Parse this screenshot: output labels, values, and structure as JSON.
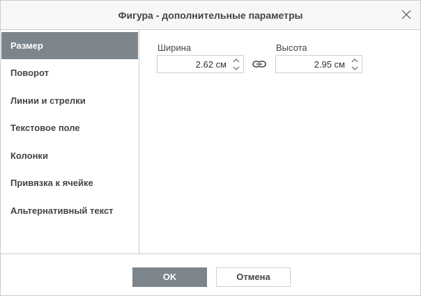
{
  "dialog": {
    "title": "Фигура - дополнительные параметры"
  },
  "sidebar": {
    "items": [
      {
        "label": "Размер",
        "active": true
      },
      {
        "label": "Поворот",
        "active": false
      },
      {
        "label": "Линии и стрелки",
        "active": false
      },
      {
        "label": "Текстовое поле",
        "active": false
      },
      {
        "label": "Колонки",
        "active": false
      },
      {
        "label": "Привязка к ячейке",
        "active": false
      },
      {
        "label": "Альтернативный текст",
        "active": false
      }
    ]
  },
  "size": {
    "width_label": "Ширина",
    "width_value": "2.62 см",
    "height_label": "Высота",
    "height_value": "2.95 см"
  },
  "footer": {
    "ok_label": "OK",
    "cancel_label": "Отмена"
  },
  "colors": {
    "active_bg": "#7d858c",
    "border": "#cbcbcb"
  }
}
